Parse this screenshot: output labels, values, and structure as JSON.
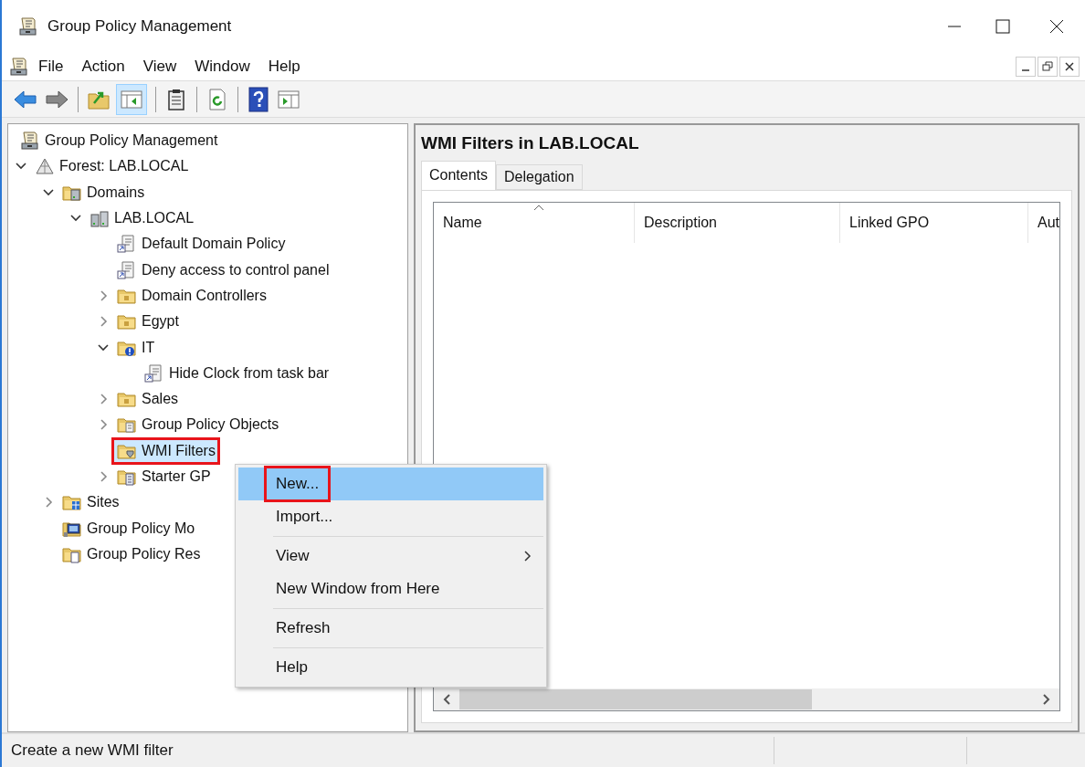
{
  "window": {
    "title": "Group Policy Management"
  },
  "menu_bar": [
    "File",
    "Action",
    "View",
    "Window",
    "Help"
  ],
  "tree": [
    {
      "label": "Group Policy Management",
      "kind": "console",
      "selected": false,
      "children": [
        {
          "label": "Forest: LAB.LOCAL",
          "kind": "forest",
          "expanded": true,
          "selected": false,
          "children": [
            {
              "label": "Domains",
              "kind": "domains",
              "expanded": true,
              "selected": false,
              "children": [
                {
                  "label": "LAB.LOCAL",
                  "kind": "domain",
                  "expanded": true,
                  "selected": false,
                  "children": [
                    {
                      "label": "Default Domain Policy",
                      "kind": "gpo",
                      "selected": false
                    },
                    {
                      "label": "Deny access to control panel",
                      "kind": "gpo",
                      "selected": false
                    },
                    {
                      "label": "Domain Controllers",
                      "kind": "ou",
                      "expanded": false,
                      "selected": false
                    },
                    {
                      "label": "Egypt",
                      "kind": "ou",
                      "expanded": false,
                      "selected": false
                    },
                    {
                      "label": "IT",
                      "kind": "warning",
                      "expanded": true,
                      "selected": false,
                      "children": [
                        {
                          "label": "Hide Clock from task bar",
                          "kind": "gpo",
                          "selected": false
                        }
                      ]
                    },
                    {
                      "label": "Sales",
                      "kind": "ou",
                      "expanded": false,
                      "selected": false
                    },
                    {
                      "label": "Group Policy Objects",
                      "kind": "gpofolder",
                      "expanded": false,
                      "selected": false
                    },
                    {
                      "label": "WMI Filters",
                      "kind": "wmi",
                      "selected": true,
                      "outlined": true
                    },
                    {
                      "label": "Starter GP",
                      "kind": "starter",
                      "expanded": false,
                      "selected": false
                    }
                  ]
                }
              ]
            },
            {
              "label": "Sites",
              "kind": "sites",
              "expanded": false,
              "selected": false
            },
            {
              "label": "Group Policy Mo",
              "kind": "modeling",
              "selected": false
            },
            {
              "label": "Group Policy Res",
              "kind": "results",
              "selected": false
            }
          ]
        }
      ]
    }
  ],
  "details": {
    "title": "WMI Filters in LAB.LOCAL",
    "tabs": [
      {
        "label": "Contents",
        "selected": true
      },
      {
        "label": "Delegation",
        "selected": false
      }
    ],
    "columns": [
      {
        "label": "Name",
        "sorted": true
      },
      {
        "label": "Description",
        "sorted": false
      },
      {
        "label": "Linked GPO",
        "sorted": false
      },
      {
        "label": "Aut",
        "sorted": false
      }
    ]
  },
  "context_menu": {
    "groups": [
      [
        {
          "label": "New...",
          "selected": true,
          "outlined": true,
          "submenu": false
        },
        {
          "label": "Import...",
          "selected": false,
          "submenu": false
        }
      ],
      [
        {
          "label": "View",
          "selected": false,
          "submenu": true
        },
        {
          "label": "New Window from Here",
          "selected": false,
          "submenu": false
        }
      ],
      [
        {
          "label": "Refresh",
          "selected": false,
          "submenu": false
        }
      ],
      [
        {
          "label": "Help",
          "selected": false,
          "submenu": false
        }
      ]
    ]
  },
  "status_bar": {
    "text": "Create a new WMI filter"
  }
}
